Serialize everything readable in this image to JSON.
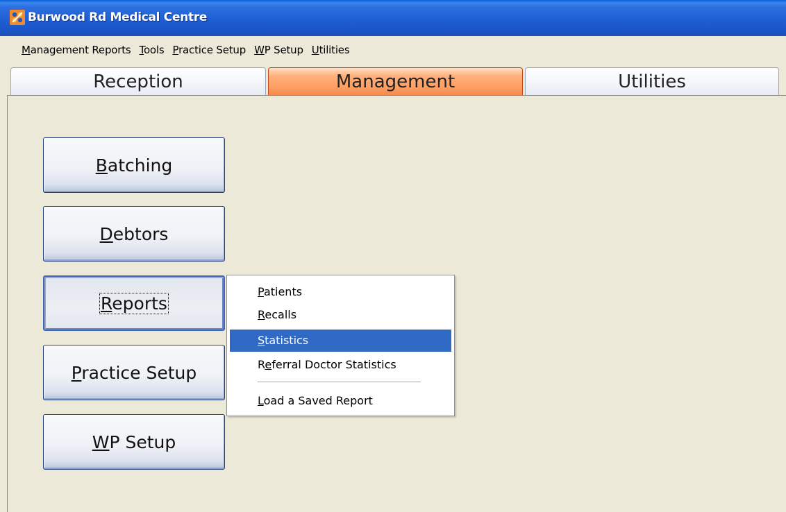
{
  "window": {
    "title": "Burwood Rd Medical Centre",
    "icon": "app-logo-icon"
  },
  "menubar": {
    "items": [
      {
        "accel": "M",
        "rest": "anagement Reports"
      },
      {
        "accel": "T",
        "rest": "ools"
      },
      {
        "accel": "P",
        "rest": "ractice Setup"
      },
      {
        "accel": "W",
        "rest": "P Setup"
      },
      {
        "accel": "U",
        "rest": "tilities"
      }
    ]
  },
  "tabs": {
    "reception": "Reception",
    "management": "Management",
    "utilities": "Utilities",
    "active": "Management"
  },
  "buttons": {
    "batching": {
      "accel": "B",
      "rest": "atching"
    },
    "debtors": {
      "accel": "D",
      "rest": "ebtors"
    },
    "reports": {
      "accel": "R",
      "rest": "eports"
    },
    "practice_setup": {
      "accel": "P",
      "rest": "ractice Setup"
    },
    "wp_setup": {
      "accel": "W",
      "rest": "P Setup"
    }
  },
  "popup": {
    "patients": {
      "accel": "P",
      "rest": "atients"
    },
    "recalls": {
      "accel": "R",
      "rest": "ecalls"
    },
    "statistics": {
      "accel": "S",
      "rest": "tatistics"
    },
    "referral": {
      "pre": "R",
      "accel": "e",
      "rest": "ferral Doctor Statistics"
    },
    "load": {
      "accel": "L",
      "rest": "oad a Saved Report"
    },
    "selected": "Statistics"
  },
  "colors": {
    "titlebar": "#1F5ED3",
    "active_tab": "#FF9F64",
    "menu_highlight": "#316AC5"
  }
}
